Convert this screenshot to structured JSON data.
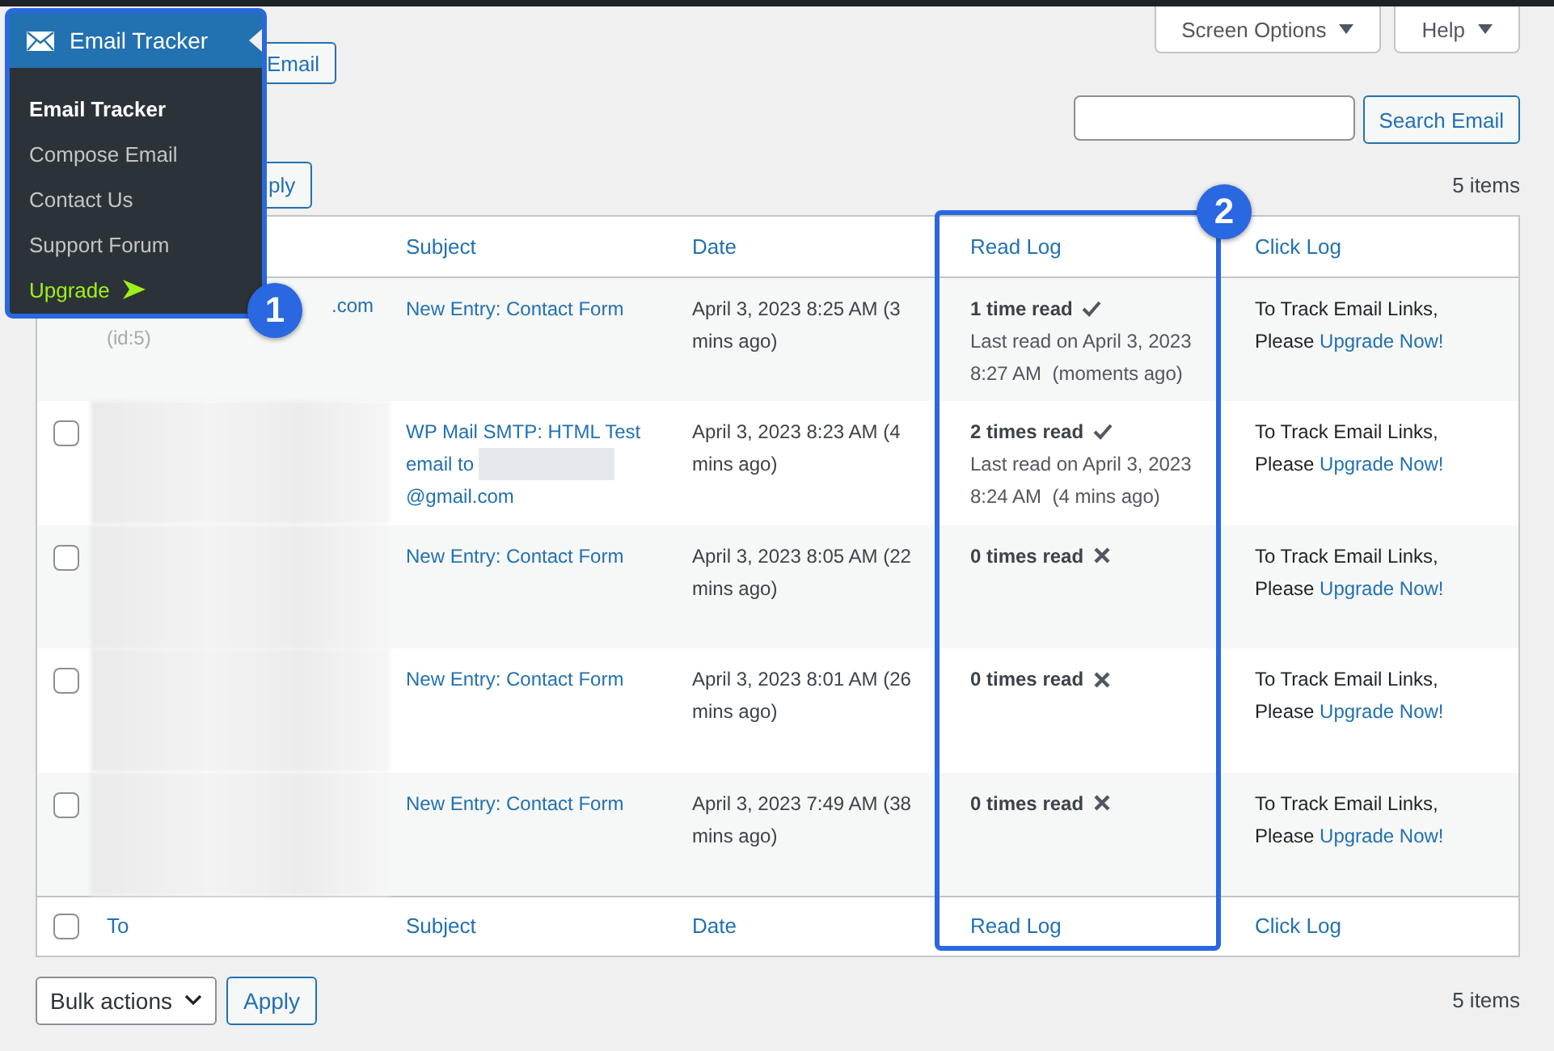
{
  "screen_options": {
    "label": "Screen Options"
  },
  "help": {
    "label": "Help"
  },
  "compose_button": {
    "label": "Email"
  },
  "search": {
    "button": "Search Email"
  },
  "top_nav": {
    "apply": "ply",
    "count": "5 items"
  },
  "table": {
    "columns": [
      "Subject",
      "Date",
      "Read Log",
      "Click Log"
    ],
    "rows": [
      {
        "to": {
          "kind": "partial",
          "text": ".com",
          "id": "(id:5)"
        },
        "subject": {
          "text": "New Entry: Contact Form"
        },
        "date": "April 3, 2023 8:25 AM (3 mins ago)",
        "read": {
          "opened": true,
          "count": "1 time read",
          "last_read": "Last read on April 3, 2023",
          "last_time": "8:27 AM  (moments ago)"
        },
        "click": {
          "note": "To Track Email Links, Please",
          "link": "Upgrade Now!"
        }
      },
      {
        "checked": false,
        "to": {
          "kind": "blurred"
        },
        "subject": {
          "text": "WP Mail SMTP: HTML Test email to",
          "redacted": true,
          "tail": "@gmail.com"
        },
        "date": "April 3, 2023 8:23 AM (4 mins ago)",
        "read": {
          "opened": true,
          "count": "2 times read",
          "last_read": "Last read on April 3, 2023",
          "last_time": "8:24 AM  (4 mins ago)"
        },
        "click": {
          "note": "To Track Email Links, Please",
          "link": "Upgrade Now!"
        }
      },
      {
        "checked": false,
        "to": {
          "kind": "blurred"
        },
        "subject": {
          "text": "New Entry: Contact Form"
        },
        "date": "April 3, 2023 8:05 AM (22 mins ago)",
        "read": {
          "opened": false,
          "count": "0 times read"
        },
        "click": {
          "note": "To Track Email Links, Please",
          "link": "Upgrade Now!"
        }
      },
      {
        "checked": false,
        "to": {
          "kind": "blurred"
        },
        "subject": {
          "text": "New Entry: Contact Form"
        },
        "date": "April 3, 2023 8:01 AM (26 mins ago)",
        "read": {
          "opened": false,
          "count": "0 times read"
        },
        "click": {
          "note": "To Track Email Links, Please",
          "link": "Upgrade Now!"
        }
      },
      {
        "checked": false,
        "to": {
          "kind": "blurred"
        },
        "subject": {
          "text": "New Entry: Contact Form"
        },
        "date": "April 3, 2023 7:49 AM (38 mins ago)",
        "read": {
          "opened": false,
          "count": "0 times read"
        },
        "click": {
          "note": "To Track Email Links, Please",
          "link": "Upgrade Now!"
        }
      }
    ],
    "footer_columns": [
      "To",
      "Subject",
      "Date",
      "Read Log",
      "Click Log"
    ],
    "footer_checked": false
  },
  "bottom_nav": {
    "bulk": "Bulk actions",
    "apply": "Apply",
    "count": "5 items"
  },
  "menu": {
    "title": "Email Tracker",
    "items": [
      {
        "label": "Email Tracker",
        "selected": true,
        "kind": "link"
      },
      {
        "label": "Compose Email",
        "selected": false,
        "kind": "link"
      },
      {
        "label": "Contact Us",
        "selected": false,
        "kind": "link"
      },
      {
        "label": "Support Forum",
        "selected": false,
        "kind": "link"
      },
      {
        "label": "Upgrade",
        "selected": false,
        "kind": "upgrade"
      }
    ]
  },
  "callouts": [
    "1",
    "2"
  ]
}
